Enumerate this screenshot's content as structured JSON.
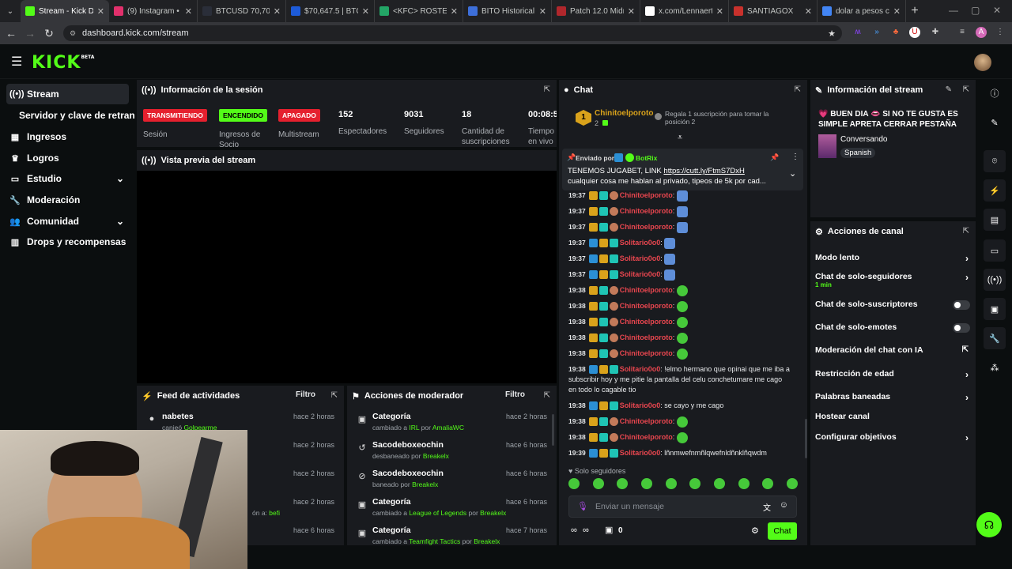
{
  "browser": {
    "tabs": [
      {
        "title": "Stream - Kick Das",
        "color": "#53fc18"
      },
      {
        "title": "(9) Instagram • M",
        "color": "#e1306c"
      },
      {
        "title": "BTCUSD 70,700 ▲",
        "color": "#2a2e39"
      },
      {
        "title": "$70,647.5 | BTCU",
        "color": "#1d5bd8"
      },
      {
        "title": "<KFC> ROSTER M",
        "color": "#23a566"
      },
      {
        "title": "BITO Historical St",
        "color": "#3d6fd9"
      },
      {
        "title": "Patch 12.0 Midnig",
        "color": "#b0272c"
      },
      {
        "title": "x.com/LennaertSn",
        "color": "#ffffff"
      },
      {
        "title": "SANTIAGOX",
        "color": "#c8312c"
      },
      {
        "title": "dolar a pesos chi",
        "color": "#4285f4"
      }
    ],
    "url": "dashboard.kick.com/stream"
  },
  "header": {
    "logo": "KICK",
    "logo_sup": "BETA"
  },
  "sidebar": {
    "items": [
      {
        "label": "Stream",
        "icon": "broadcast-icon"
      },
      {
        "label": "Servidor y clave de retransm",
        "icon": ""
      },
      {
        "label": "Ingresos",
        "icon": "chart-icon"
      },
      {
        "label": "Logros",
        "icon": "trophy-icon"
      },
      {
        "label": "Estudio",
        "icon": "studio-icon"
      },
      {
        "label": "Moderación",
        "icon": "wrench-icon"
      },
      {
        "label": "Comunidad",
        "icon": "community-icon"
      },
      {
        "label": "Drops y recompensas",
        "icon": "drops-icon"
      }
    ]
  },
  "session": {
    "title": "Información de la sesión",
    "badges": [
      {
        "label": "TRANSMITIENDO",
        "caption": "Sesión",
        "color": "#e5202e"
      },
      {
        "label": "ENCENDIDO",
        "caption": "Ingresos de Socio",
        "color": "#53fc18"
      },
      {
        "label": "APAGADO",
        "caption": "Multistream",
        "color": "#e5202e"
      }
    ],
    "stats": [
      {
        "value": "152",
        "label": "Espectadores"
      },
      {
        "value": "9031",
        "label": "Seguidores"
      },
      {
        "value": "18",
        "label": "Cantidad de suscripciones"
      },
      {
        "value": "00:08:5",
        "label": "Tiempo en vivo"
      }
    ]
  },
  "preview": {
    "title": "Vista previa del stream"
  },
  "feed": {
    "title": "Feed de actividades",
    "filter": "Filtro",
    "rows": [
      {
        "title": "nabetes",
        "sub": "canjeó",
        "sub_hl": "Golpearme",
        "time": "hace 2 horas"
      },
      {
        "title": "",
        "sub": "",
        "sub_hl": "",
        "time": "hace 2 horas"
      },
      {
        "title": "",
        "sub": "",
        "sub_hl": "",
        "time": "hace 2 horas"
      },
      {
        "title": "",
        "sub": "ón a:",
        "sub_hl": "befi",
        "time": "hace 2 horas"
      },
      {
        "title": "",
        "sub": "",
        "sub_hl": "",
        "time": "hace 6 horas"
      }
    ]
  },
  "modactions": {
    "title": "Acciones de moderador",
    "filter": "Filtro",
    "rows": [
      {
        "title": "Categoría",
        "sub_a": "cambiado a",
        "hl1": "IRL",
        "sub_b": "por",
        "hl2": "AmaliaWC",
        "time": "hace 2 horas",
        "icon": "category-icon"
      },
      {
        "title": "Sacodeboxeochin",
        "sub_a": "desbaneado por",
        "hl1": "Breakelx",
        "sub_b": "",
        "hl2": "",
        "time": "hace 6 horas",
        "icon": "unban-icon"
      },
      {
        "title": "Sacodeboxeochin",
        "sub_a": "baneado por",
        "hl1": "Breakelx",
        "sub_b": "",
        "hl2": "",
        "time": "hace 6 horas",
        "icon": "ban-icon"
      },
      {
        "title": "Categoría",
        "sub_a": "cambiado a",
        "hl1": "League of Legends",
        "sub_b": "por",
        "hl2": "Breakelx",
        "time": "hace 6 horas",
        "icon": "category-icon"
      },
      {
        "title": "Categoría",
        "sub_a": "cambiado a",
        "hl1": "Teamfight Tactics",
        "sub_b": "por",
        "hl2": "Breakelx",
        "time": "hace 7 horas",
        "icon": "category-icon"
      }
    ]
  },
  "chat": {
    "title": "Chat",
    "gifter": {
      "rank": "1",
      "name": "Chinitoelporoto",
      "count": "2",
      "prompt": "Regala 1 suscripción para tomar la posición 2"
    },
    "pinned": {
      "by_label": "Enviado por",
      "by": "BotRix",
      "text1": "TENEMOS JUGABET, LINK ",
      "link": "https://cutt.ly/FtmS7DxH",
      "text2": "cualquier cosa me hablan al privado, tipeos de 5k por cad..."
    },
    "messages": [
      {
        "time": "19:37",
        "user": "Chinitoelporoto",
        "text": "",
        "emote": "em-b"
      },
      {
        "time": "19:37",
        "user": "Chinitoelporoto",
        "text": "",
        "emote": "em-b"
      },
      {
        "time": "19:37",
        "user": "Chinitoelporoto",
        "text": "",
        "emote": "em-b"
      },
      {
        "time": "19:37",
        "user": "Solitario0o0",
        "text": "",
        "emote": "em-b"
      },
      {
        "time": "19:37",
        "user": "Solitario0o0",
        "text": "",
        "emote": "em-b"
      },
      {
        "time": "19:37",
        "user": "Solitario0o0",
        "text": "",
        "emote": "em-b"
      },
      {
        "time": "19:38",
        "user": "Chinitoelporoto",
        "text": "",
        "emote": "em-g"
      },
      {
        "time": "19:38",
        "user": "Chinitoelporoto",
        "text": "",
        "emote": "em-g"
      },
      {
        "time": "19:38",
        "user": "Chinitoelporoto",
        "text": "",
        "emote": "em-g"
      },
      {
        "time": "19:38",
        "user": "Chinitoelporoto",
        "text": "",
        "emote": "em-g"
      },
      {
        "time": "19:38",
        "user": "Chinitoelporoto",
        "text": "",
        "emote": "em-g"
      }
    ],
    "long_msg": {
      "time": "19:38",
      "user": "Solitario0o0",
      "l1": "!elmo hermano que opinai que me iba a",
      "l2": "subscribir hoy y me pitie la pantalla del celu conchetumare me cago",
      "l3": "en todo lo cagable tio"
    },
    "msg2": {
      "time": "19:38",
      "user": "Solitario0o0",
      "text": "se cayo y me cago"
    },
    "msg3": {
      "time": "19:38",
      "user": "Chinitoelporoto"
    },
    "msg4": {
      "time": "19:38",
      "user": "Chinitoelporoto"
    },
    "msg5": {
      "time": "19:39",
      "user": "Solitario0o0",
      "text": "lñnmwefnmñlqwefnldñnklñqwdm"
    },
    "followers_only": "Solo seguidores",
    "input_placeholder": "Enviar un mensaje",
    "points": "0",
    "send": "Chat"
  },
  "streaminfo": {
    "title": "Información del stream",
    "stream_title": "💗 BUEN DIA 👄 SI NO TE GUSTA ES SIMPLE APRETA CERRAR PESTAÑA 👄...",
    "category": "Conversando",
    "language": "Spanish"
  },
  "channelactions": {
    "title": "Acciones de canal",
    "items": [
      {
        "label": "Modo lento",
        "sub": "",
        "control": "arrow"
      },
      {
        "label": "Chat de solo-seguidores",
        "sub": "1 min",
        "control": "arrow"
      },
      {
        "label": "Chat de solo-suscriptores",
        "sub": "",
        "control": "toggle"
      },
      {
        "label": "Chat de solo-emotes",
        "sub": "",
        "control": "toggle"
      },
      {
        "label": "Moderación del chat con IA",
        "sub": "",
        "control": "ext"
      },
      {
        "label": "Restricción de edad",
        "sub": "",
        "control": "arrow"
      },
      {
        "label": "Palabras baneadas",
        "sub": "",
        "control": "arrow"
      },
      {
        "label": "Hostear canal",
        "sub": "",
        "control": "none"
      },
      {
        "label": "Configurar objetivos",
        "sub": "",
        "control": "arrow"
      }
    ]
  },
  "colors": {
    "kick_green": "#53fc18",
    "live_red": "#e5202e",
    "user_red": "#e8464f"
  }
}
